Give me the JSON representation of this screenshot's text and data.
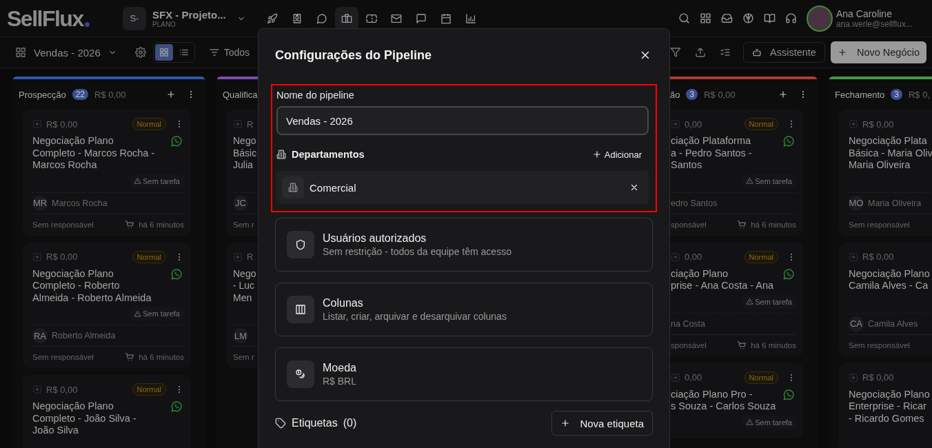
{
  "header": {
    "logo": "SellFlux",
    "project": {
      "initials": "S-",
      "name": "SFX - Projeto...",
      "plan": "PLANO"
    },
    "nav": [
      {
        "selected": false
      },
      {
        "selected": false
      },
      {
        "selected": false
      },
      {
        "selected": true
      },
      {
        "selected": false
      },
      {
        "selected": false
      },
      {
        "selected": false
      },
      {
        "selected": false
      },
      {
        "selected": false
      }
    ],
    "user": {
      "name": "Ana Caroline",
      "email": "ana.werle@sellflux..."
    }
  },
  "toolbar": {
    "pipeline": "Vendas - 2026",
    "views": [
      {
        "selected": true
      },
      {
        "selected": false
      }
    ],
    "filter": "Todos",
    "assistant": "Assistente",
    "new_deal": "Novo Negócio"
  },
  "columns": [
    {
      "title": "Prospecção",
      "count": "22",
      "total": "R$ 0,00",
      "color": "#2f56a8",
      "actions": true,
      "cards": [
        {
          "amount": "R$ 0,00",
          "priority": "Normal",
          "title": "Negociação Plano\nCompleto - Marcos Rocha -\nMarcos Rocha",
          "task": "Sem tarefa",
          "initials": "MR",
          "contact": "Marcos Rocha",
          "owner": "Sem responsável",
          "time": "há 6 minutos"
        },
        {
          "amount": "R$ 0,00",
          "priority": "Normal",
          "title": "Negociação Plano\nCompleto - Roberto\nAlmeida - Roberto Almeida",
          "task": "Sem tarefa",
          "initials": "RA",
          "contact": "Roberto Almeida",
          "owner": "Sem responsável",
          "time": "há 6 minutos"
        },
        {
          "amount": "R$ 0,00",
          "priority": "Normal",
          "title": "Negociação Plano\nCompleto - João Silva -\nJoão Silva"
        }
      ]
    },
    {
      "title": "Qualifica",
      "color": "#7a4fb0",
      "cards": [
        {
          "amount": "R",
          "title": "Nego\nBásic\nJulia",
          "initials": "JC",
          "owner": "Sem r"
        },
        {
          "amount": "R",
          "title": "Nego\n- Luc\nMen",
          "initials": "LM",
          "owner": "Sem r"
        }
      ]
    },
    {
      "title": "ão",
      "count": "3",
      "total": "R$ 0,00",
      "color": "#b03a32",
      "actions": true,
      "cards": [
        {
          "amount": "0,00",
          "priority": "Normal",
          "title": "ciação Plataforma\na - Pedro Santos -\nSantos",
          "task": "Sem tarefa",
          "contact": "edro Santos",
          "owner": "sponsável",
          "time": "há 6 minutos"
        },
        {
          "amount": "0,00",
          "priority": "Normal",
          "title": "ciação Plano\nprise - Ana Costa - Ana",
          "task": "Sem tarefa",
          "contact": "na Costa",
          "owner": "sponsável",
          "time": "há 6 minutos"
        },
        {
          "amount": "0,00",
          "priority": "Normal",
          "title": "ciação Plano Pro -\ns Souza - Carlos Souza",
          "task": "Sem tarefa"
        }
      ]
    },
    {
      "title": "Fechamento",
      "count": "3",
      "total": "R$ 0,",
      "color": "#3f9a45",
      "cards": [
        {
          "amount": "R$ 0,00",
          "title": "Negociação Plata\nBásica - Maria Oliv\nMaria Oliveira",
          "initials": "MO",
          "contact": "Maria Oliveira",
          "owner": "Sem responsável"
        },
        {
          "amount": "R$ 0,00",
          "title": "Negociação Plano\nCamila Alves - Ca",
          "initials": "CA",
          "contact": "Camila Alves",
          "owner": "Sem responsável"
        },
        {
          "amount": "R$ 0,00",
          "title": "Negociação Plano\nEnterprise - Ricar\n- Ricardo Gomes"
        }
      ]
    }
  ],
  "modal": {
    "title": "Configurações do Pipeline",
    "section": {
      "highlighted": true,
      "label": "Nome do pipeline",
      "value": "Vendas - 2026",
      "departments_title": "Departamentos",
      "add": "Adicionar",
      "departments": [
        "Comercial"
      ]
    },
    "options": [
      {
        "title": "Usuários autorizados",
        "subtitle": "Sem restrição - todos da equipe têm acesso"
      },
      {
        "title": "Colunas",
        "subtitle": "Listar, criar, arquivar e desarquivar colunas"
      },
      {
        "title": "Moeda",
        "subtitle": "R$ BRL"
      }
    ],
    "tags": {
      "title": "Etiquetas",
      "count": "(0)",
      "button": "Nova etiqueta"
    }
  }
}
